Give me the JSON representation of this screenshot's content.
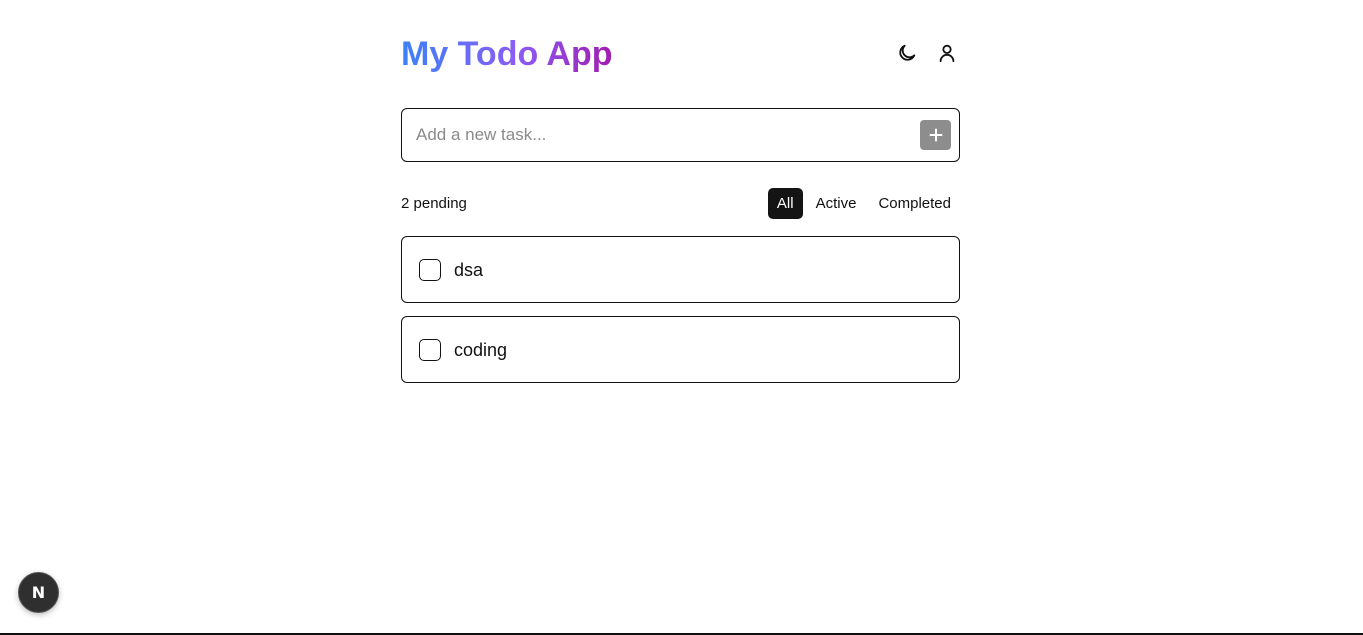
{
  "header": {
    "title": "My Todo App",
    "theme_icon": "moon-icon",
    "account_icon": "user-icon"
  },
  "new_task": {
    "placeholder": "Add a new task...",
    "value": "",
    "add_icon": "plus-icon"
  },
  "status": {
    "pending_label": "2 pending"
  },
  "filters": [
    {
      "label": "All",
      "active": true
    },
    {
      "label": "Active",
      "active": false
    },
    {
      "label": "Completed",
      "active": false
    }
  ],
  "todos": [
    {
      "text": "dsa",
      "completed": false
    },
    {
      "text": "coding",
      "completed": false
    }
  ],
  "dev_badge": {
    "label": "N",
    "icon": "nextjs-icon"
  },
  "colors": {
    "title_gradient_start": "#3b82f6",
    "title_gradient_end": "#a21caf",
    "active_filter_bg": "#141414",
    "add_button_bg": "#8d8d8d"
  }
}
